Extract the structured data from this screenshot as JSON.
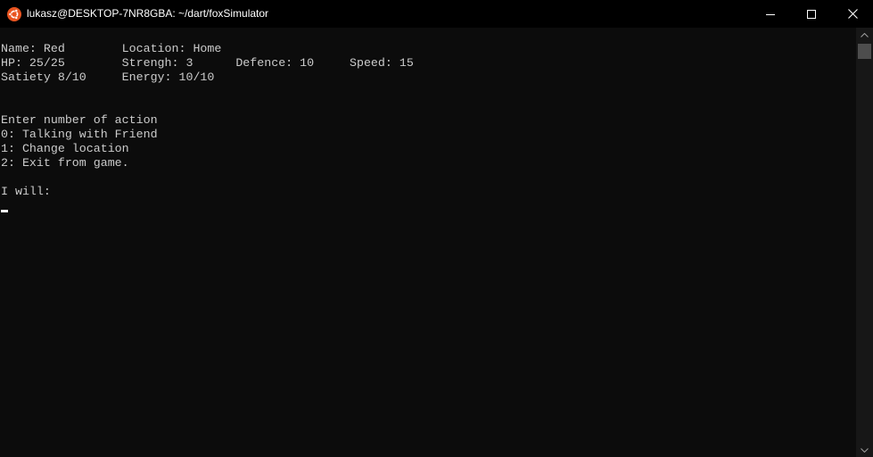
{
  "window": {
    "title": "lukasz@DESKTOP-7NR8GBA: ~/dart/foxSimulator",
    "app_icon": "ubuntu-icon",
    "controls": [
      "minimize-icon",
      "maximize-icon",
      "close-icon"
    ]
  },
  "terminal": {
    "lines": [
      "",
      "Name: Red        Location: Home",
      "HP: 25/25        Strengh: 3      Defence: 10     Speed: 15",
      "Satiety 8/10     Energy: 10/10",
      "",
      "",
      "Enter number of action",
      "0: Talking with Friend",
      "1: Change location",
      "2: Exit from game.",
      "",
      "I will:"
    ]
  },
  "colors": {
    "background": "#0c0c0c",
    "text": "#cccccc",
    "titlebar": "#000000",
    "ubuntu_orange": "#e95420",
    "scrollbar_track": "#171717",
    "scrollbar_thumb": "#4d4d4d"
  }
}
